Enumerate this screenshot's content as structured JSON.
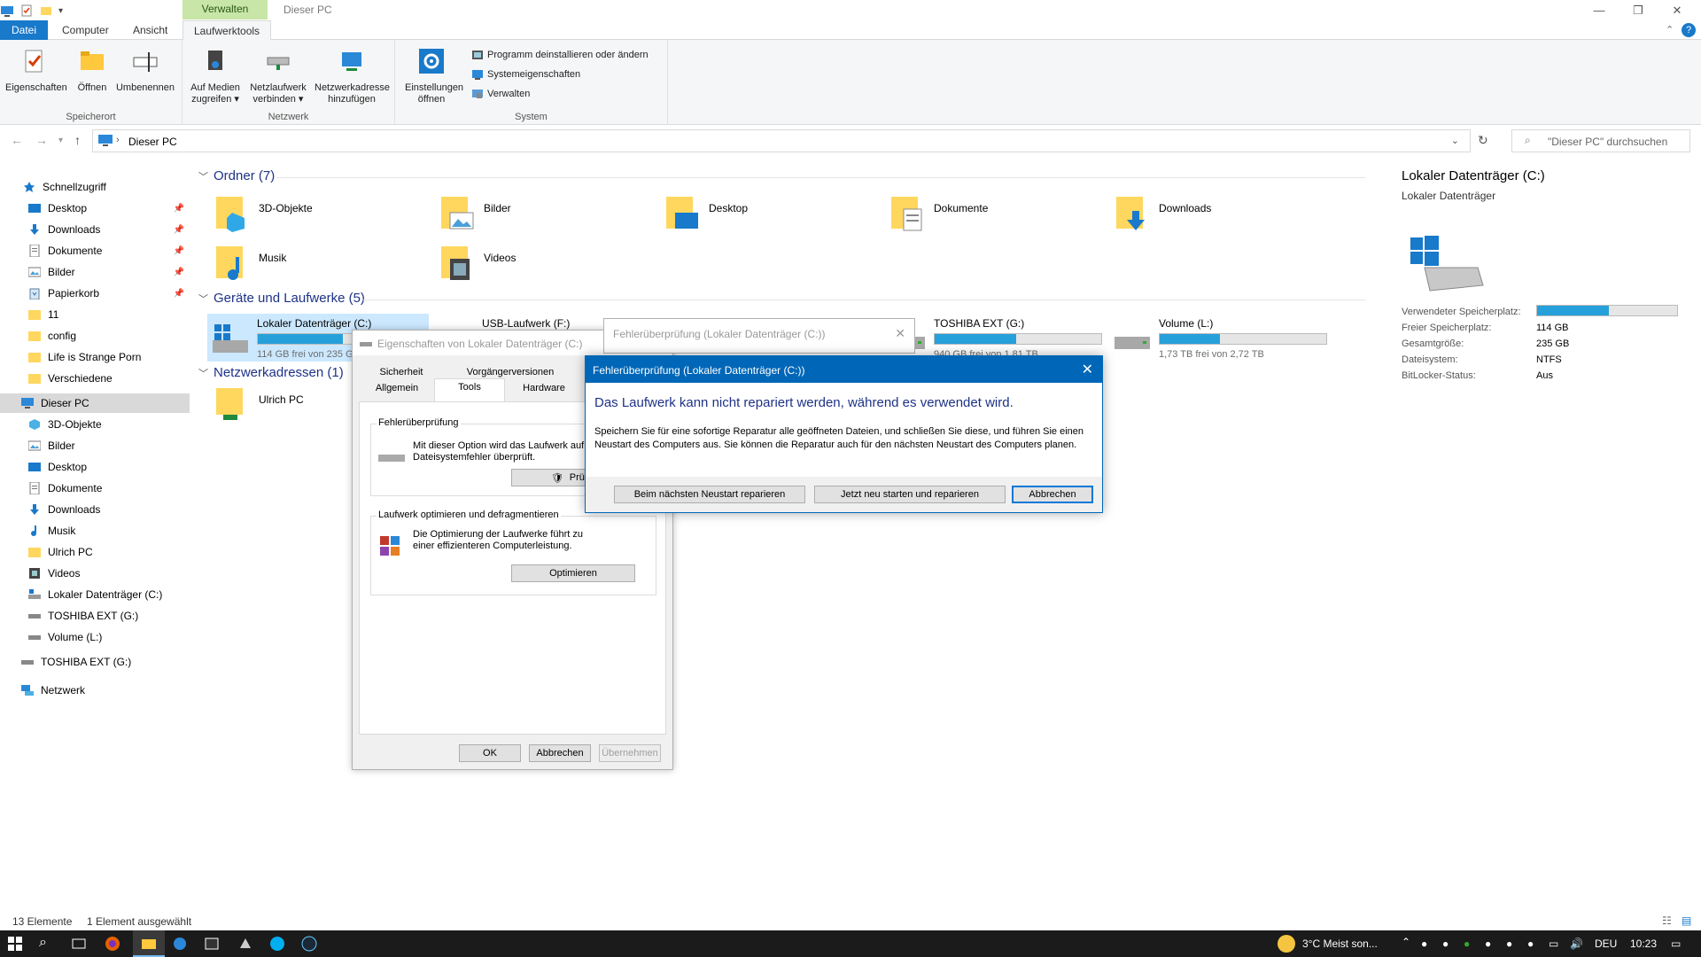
{
  "titlebar": {
    "context_tab_header": "Verwalten",
    "window_title": "Dieser PC",
    "controls": [
      "—",
      "❐",
      "✕"
    ]
  },
  "ribbon_tabs": [
    "Datei",
    "Computer",
    "Ansicht",
    "Laufwerktools"
  ],
  "ribbon": {
    "groups": [
      {
        "label": "Speicherort",
        "buttons": [
          "Eigenschaften",
          "Öffnen",
          "Umbenennen"
        ]
      },
      {
        "label": "Netzwerk",
        "buttons": [
          "Auf Medien zugreifen ▾",
          "Netzlaufwerk verbinden ▾",
          "Netzwerkadresse hinzufügen"
        ]
      },
      {
        "label": "System",
        "big_button": "Einstellungen öffnen",
        "small_buttons": [
          "Programm deinstallieren oder ändern",
          "Systemeigenschaften",
          "Verwalten"
        ]
      }
    ]
  },
  "address": {
    "path": "Dieser PC",
    "search_placeholder": "\"Dieser PC\" durchsuchen"
  },
  "sidebar": {
    "quick_access": "Schnellzugriff",
    "quick_items": [
      "Desktop",
      "Downloads",
      "Dokumente",
      "Bilder",
      "Papierkorb",
      "11",
      "config",
      "Life is Strange Porn",
      "Verschiedene"
    ],
    "this_pc": "Dieser PC",
    "pc_items": [
      "3D-Objekte",
      "Bilder",
      "Desktop",
      "Dokumente",
      "Downloads",
      "Musik",
      "Ulrich PC",
      "Videos",
      "Lokaler Datenträger (C:)",
      "TOSHIBA EXT (G:)",
      "Volume (L:)"
    ],
    "external": "TOSHIBA EXT (G:)",
    "network": "Netzwerk"
  },
  "content": {
    "folders_header": "Ordner (7)",
    "folders": [
      "3D-Objekte",
      "Bilder",
      "Desktop",
      "Dokumente",
      "Downloads",
      "Musik",
      "Videos"
    ],
    "drives_header": "Geräte und Laufwerke (5)",
    "drives": [
      {
        "name": "Lokaler Datenträger (C:)",
        "free": "114 GB frei von 235 GB",
        "used_fraction": 0.51
      },
      {
        "name": "USB-Laufwerk (F:)",
        "free": "",
        "used_fraction": 0
      },
      {
        "name": "TOSHIBA EXT (G:)",
        "free": "940 GB frei von 1,81 TB",
        "used_fraction": 0.49
      },
      {
        "name": "Volume (L:)",
        "free": "1,73 TB frei von 2,72 TB",
        "used_fraction": 0.36
      }
    ],
    "network_header": "Netzwerkadressen (1)",
    "network_items": [
      "Ulrich PC"
    ]
  },
  "details": {
    "title": "Lokaler Datenträger (C:)",
    "subtitle": "Lokaler Datenträger",
    "used_label": "Verwendeter Speicherplatz:",
    "used_fraction": 0.51,
    "rows": [
      {
        "label": "Freier Speicherplatz:",
        "value": "114 GB"
      },
      {
        "label": "Gesamtgröße:",
        "value": "235 GB"
      },
      {
        "label": "Dateisystem:",
        "value": "NTFS"
      },
      {
        "label": "BitLocker-Status:",
        "value": "Aus"
      }
    ]
  },
  "statusbar": {
    "count": "13 Elemente",
    "selection": "1 Element ausgewählt"
  },
  "props_dialog": {
    "title": "Eigenschaften von Lokaler Datenträger (C:)",
    "tabs_row1": [
      "Sicherheit",
      "Vorgängerversionen"
    ],
    "tabs_row2": [
      "Allgemein",
      "Tools",
      "Hardware"
    ],
    "error_group_title": "Fehlerüberprüfung",
    "error_group_text": "Mit dieser Option wird das Laufwerk auf Dateisystemfehler überprüft.",
    "error_button": "Prüfen",
    "optimize_group_title": "Laufwerk optimieren und defragmentieren",
    "optimize_group_text": "Die Optimierung der Laufwerke führt zu einer effizienteren Computerleistung.",
    "optimize_button": "Optimieren",
    "buttons": [
      "OK",
      "Abbrechen",
      "Übernehmen"
    ]
  },
  "err_back_dialog": {
    "title": "Fehlerüberprüfung (Lokaler Datenträger (C:))"
  },
  "err_dialog": {
    "title": "Fehlerüberprüfung (Lokaler Datenträger (C:))",
    "heading": "Das Laufwerk kann nicht repariert werden, während es verwendet wird.",
    "message": "Speichern Sie für eine sofortige Reparatur alle geöffneten Dateien, und schließen Sie diese, und führen Sie einen Neustart des Computers aus. Sie können die Reparatur auch für den nächsten Neustart des Computers planen.",
    "buttons": [
      "Beim nächsten Neustart reparieren",
      "Jetzt neu starten und reparieren",
      "Abbrechen"
    ]
  },
  "taskbar": {
    "weather": "3°C  Meist son...",
    "language": "DEU",
    "time": "10:23"
  },
  "colors": {
    "accent": "#0067b8",
    "drive_bar": "#26a0da",
    "context_tab": "#c8e6a8"
  }
}
